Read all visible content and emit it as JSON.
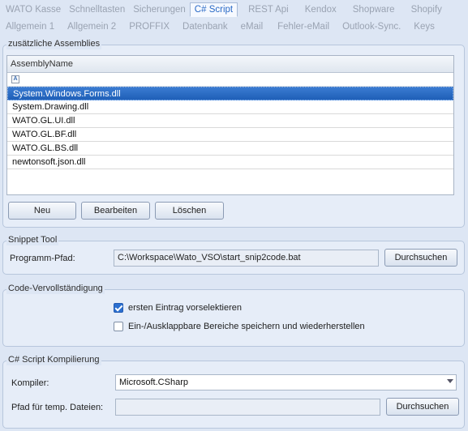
{
  "tabs_row1": [
    "WATO Kasse",
    "Schnelltasten",
    "Sicherungen",
    "C# Script",
    "REST Api",
    "Kendox",
    "Shopware",
    "Shopify"
  ],
  "tabs_row2": [
    "Allgemein 1",
    "Allgemein 2",
    "PROFFIX",
    "Datenbank",
    "eMail",
    "Fehler-eMail",
    "Outlook-Sync.",
    "Keys"
  ],
  "active_tab": "C# Script",
  "assemblies": {
    "title": "zusätzliche Assemblies",
    "column_header": "AssemblyName",
    "filter_icon_text": "A",
    "rows": [
      "System.Windows.Forms.dll",
      "System.Drawing.dll",
      "WATO.GL.UI.dll",
      "WATO.GL.BF.dll",
      "WATO.GL.BS.dll",
      "newtonsoft.json.dll"
    ],
    "selected_row": 0,
    "buttons": {
      "new": "Neu",
      "edit": "Bearbeiten",
      "delete": "Löschen"
    }
  },
  "snippet": {
    "title": "Snippet Tool",
    "path_label": "Programm-Pfad:",
    "path_value": "C:\\Workspace\\Wato_VSO\\start_snip2code.bat",
    "browse": "Durchsuchen"
  },
  "completion": {
    "title": "Code-Vervollständigung",
    "option1": {
      "label": "ersten Eintrag vorselektieren",
      "checked": true
    },
    "option2": {
      "label": "Ein-/Ausklappbare Bereiche speichern und wiederherstellen",
      "checked": false
    }
  },
  "compile": {
    "title": "C# Script Kompilierung",
    "compiler_label": "Kompiler:",
    "compiler_value": "Microsoft.CSharp",
    "temp_label": "Pfad für temp. Dateien:",
    "temp_value": "",
    "browse": "Durchsuchen"
  },
  "colors": {
    "accent": "#2a6ac6",
    "selection": "#1f5fb7",
    "background": "#dde6f4"
  }
}
